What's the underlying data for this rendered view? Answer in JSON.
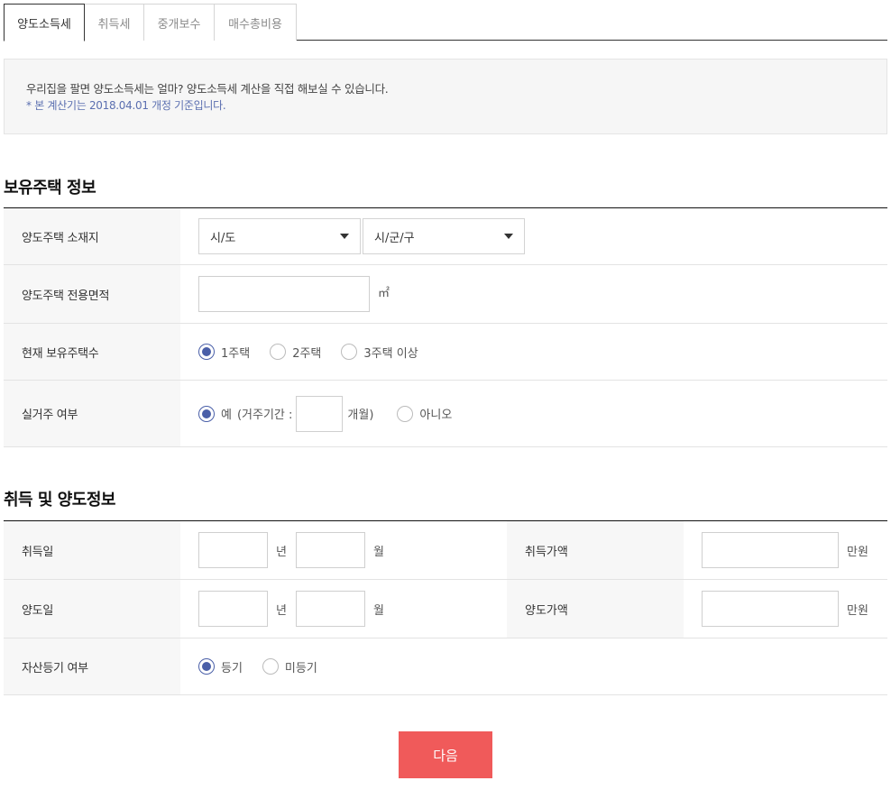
{
  "tabs": [
    {
      "label": "양도소득세",
      "active": true
    },
    {
      "label": "취득세",
      "active": false
    },
    {
      "label": "중개보수",
      "active": false
    },
    {
      "label": "매수총비용",
      "active": false
    }
  ],
  "notice": {
    "line1": "우리집을 팔면 양도소득세는 얼마? 양도소득세 계산을 직접 해보실 수 있습니다.",
    "line2": "* 본 계산기는 2018.04.01 개정 기준입니다."
  },
  "section1": {
    "title": "보유주택 정보",
    "location_label": "양도주택 소재지",
    "sido_select": "시/도",
    "sigungu_select": "시/군/구",
    "area_label": "양도주택 전용면적",
    "area_unit": "㎡",
    "count_label": "현재 보유주택수",
    "count_options": [
      "1주택",
      "2주택",
      "3주택 이상"
    ],
    "count_selected": 0,
    "residence_label": "실거주 여부",
    "residence_yes": "예",
    "residence_period_prefix": "(거주기간 :",
    "residence_period_suffix": "개월)",
    "residence_no": "아니오"
  },
  "section2": {
    "title": "취득 및 양도정보",
    "acq_date_label": "취득일",
    "trans_date_label": "양도일",
    "year_unit": "년",
    "month_unit": "월",
    "acq_price_label": "취득가액",
    "trans_price_label": "양도가액",
    "price_unit": "만원",
    "reg_label": "자산등기 여부",
    "reg_options": [
      "등기",
      "미등기"
    ],
    "reg_selected": 0
  },
  "next_button": "다음",
  "colors": {
    "accent": "#4a5fa8",
    "button": "#f05a5a",
    "notice_sub": "#5b6fb0"
  }
}
